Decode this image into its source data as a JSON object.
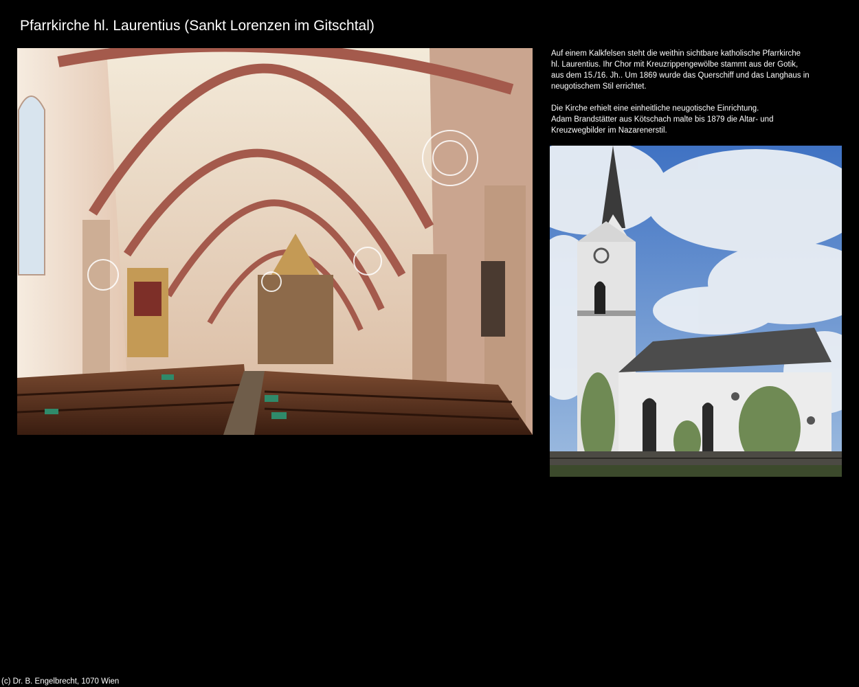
{
  "page": {
    "title": "Pfarrkirche hl. Laurentius (Sankt Lorenzen im Gitschtal)",
    "footer": "(c) Dr. B. Engelbrecht, 1070 Wien"
  },
  "description": {
    "paragraph_1": "Auf einem Kalkfelsen steht die weithin sichtbare katholische Pfarrkirche\nhl. Laurentius. Ihr Chor mit Kreuzrippengewölbe stammt aus der Gotik,\naus dem 15./16. Jh.. Um 1869 wurde das Querschiff und das Langhaus in\nneugotischem Stil errichtet.",
    "paragraph_2": "Die Kirche erhielt eine einheitliche neugotische Einrichtung.\nAdam Brandstätter aus Kötschach malte bis 1879 die Altar- und\nKreuzwegbilder im Nazarenerstil."
  },
  "photos": {
    "interior": {
      "icon": "church-interior-photo"
    },
    "exterior": {
      "icon": "church-exterior-photo"
    }
  },
  "colors": {
    "background": "#000000",
    "text": "#ffffff",
    "vault_light": "#efe4d4",
    "rib_red": "#a45a4c",
    "pew_brown": "#5a2f1c",
    "sky_blue": "#4f7fca",
    "roof_gray": "#4c4c4c"
  }
}
